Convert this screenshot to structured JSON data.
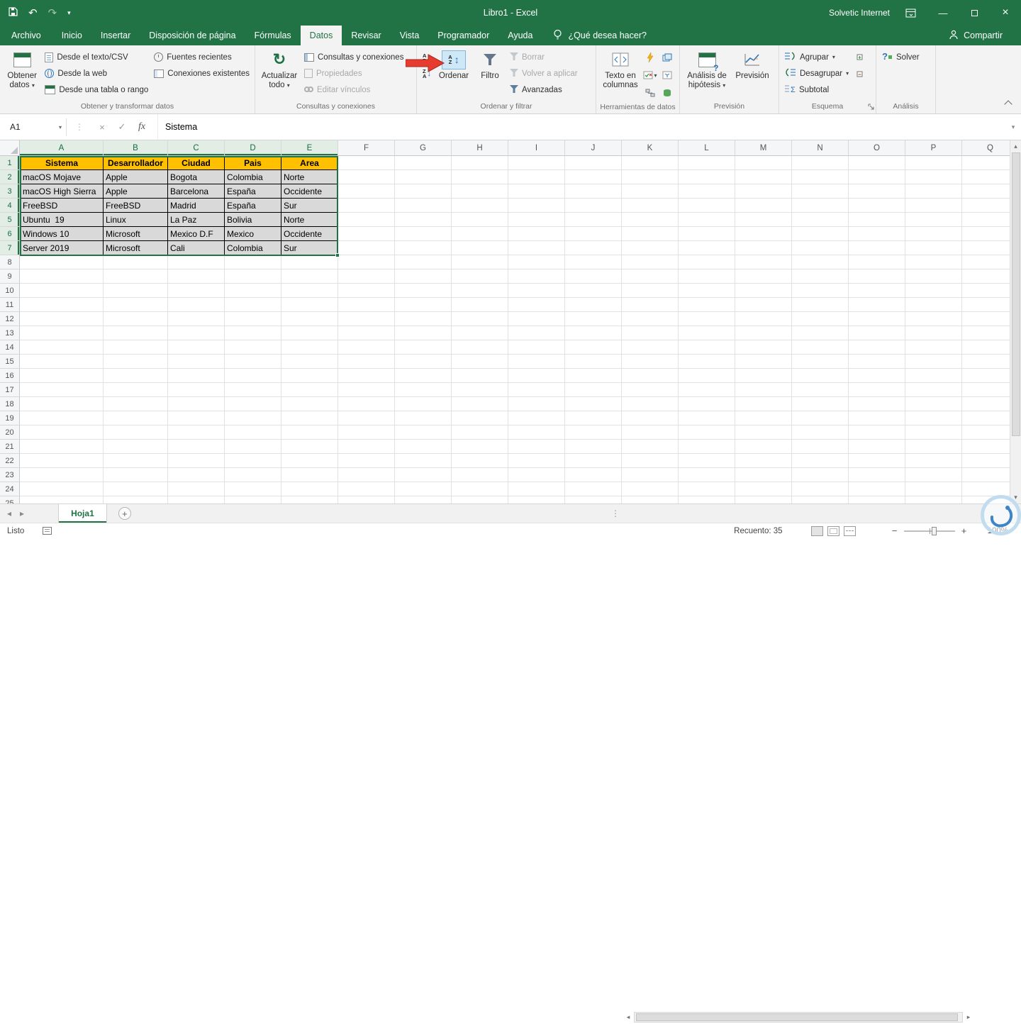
{
  "titlebar": {
    "title": "Libro1  -  Excel",
    "account": "Solvetic Internet"
  },
  "tabs": {
    "file": "Archivo",
    "items": [
      "Inicio",
      "Insertar",
      "Disposición de página",
      "Fórmulas",
      "Datos",
      "Revisar",
      "Vista",
      "Programador",
      "Ayuda"
    ],
    "active": "Datos",
    "tell_me": "¿Qué desea hacer?",
    "share": "Compartir"
  },
  "ribbon": {
    "get": {
      "title": "Obtener y transformar datos",
      "big": "Obtener datos",
      "items": [
        "Desde el texto/CSV",
        "Desde la web",
        "Desde una tabla o rango",
        "Fuentes recientes",
        "Conexiones existentes"
      ]
    },
    "q": {
      "title": "Consultas y conexiones",
      "big": "Actualizar todo",
      "items": [
        "Consultas y conexiones",
        "Propiedades",
        "Editar vínculos"
      ]
    },
    "sort": {
      "title": "Ordenar y filtrar",
      "ordenar": "Ordenar",
      "filtro": "Filtro",
      "items": [
        "Borrar",
        "Volver a aplicar",
        "Avanzadas"
      ]
    },
    "tools": {
      "title": "Herramientas de datos",
      "big": "Texto en columnas"
    },
    "fc": {
      "title": "Previsión",
      "hip": "Análisis de hipótesis",
      "prev": "Previsión"
    },
    "out": {
      "title": "Esquema",
      "items": [
        "Agrupar",
        "Desagrupar",
        "Subtotal"
      ]
    },
    "an": {
      "title": "Análisis",
      "solver": "Solver"
    }
  },
  "formula": {
    "name_box": "A1",
    "value": "Sistema"
  },
  "grid": {
    "columns": [
      "A",
      "B",
      "C",
      "D",
      "E",
      "F",
      "G",
      "H",
      "I",
      "J",
      "K",
      "L",
      "M",
      "N",
      "O",
      "P",
      "Q"
    ],
    "row_count": 25,
    "selected_columns": [
      "A",
      "B",
      "C",
      "D",
      "E"
    ],
    "selected_rows": [
      1,
      2,
      3,
      4,
      5,
      6,
      7
    ],
    "table": {
      "header": [
        "Sistema",
        "Desarrollador",
        "Ciudad",
        "Pais",
        "Area"
      ],
      "rows": [
        [
          "macOS Mojave",
          "Apple",
          "Bogota",
          "Colombia",
          "Norte"
        ],
        [
          "macOS High Sierra",
          "Apple",
          "Barcelona",
          "España",
          "Occidente"
        ],
        [
          "FreeBSD",
          "FreeBSD",
          "Madrid",
          "España",
          "Sur"
        ],
        [
          "Ubuntu  19",
          "Linux",
          "La Paz",
          "Bolivia",
          "Norte"
        ],
        [
          "Windows 10",
          "Microsoft",
          "Mexico D.F",
          "Mexico",
          "Occidente"
        ],
        [
          "Server 2019",
          "Microsoft",
          "Cali",
          "Colombia",
          "Sur"
        ]
      ],
      "header_bg": "#FFC000",
      "row_bg": "#D9D9D9"
    }
  },
  "sheet": {
    "name": "Hoja1"
  },
  "status": {
    "ready": "Listo",
    "count": "Recuento: 35",
    "zoom": "100%"
  },
  "colors": {
    "excel_green": "#217346",
    "table_header": "#FFC000",
    "table_rows": "#D9D9D9",
    "arrow_red": "#E63B2E"
  },
  "icons": {
    "caret": "▾",
    "dots": "⋮",
    "close": "×",
    "check": "✓",
    "fx": "fx",
    "undo": "↶",
    "redo": "↷",
    "dash": "—",
    "left": "◂",
    "right": "▸",
    "up": "▴",
    "down": "▾",
    "plus": "+",
    "minus": "−",
    "refresh": "↻",
    "a": "A",
    "z": "Z",
    "darr": "↓",
    "udarr": "↕",
    "q": "?"
  }
}
